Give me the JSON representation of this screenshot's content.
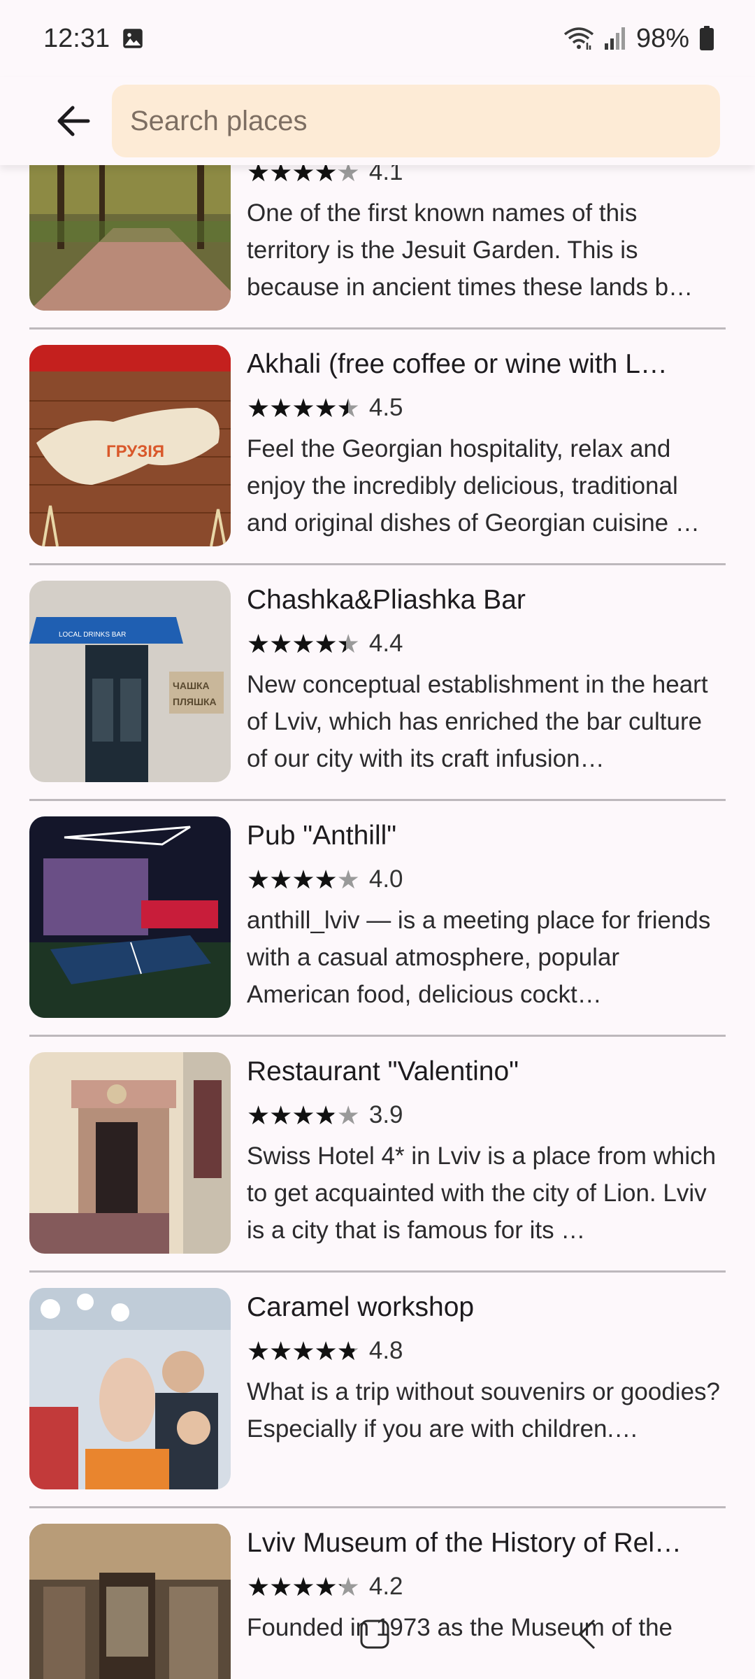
{
  "status_bar": {
    "time": "12:31",
    "battery": "98%",
    "icons": [
      "image-icon",
      "wifi-icon",
      "signal-icon",
      "battery-icon"
    ]
  },
  "header": {
    "back_icon": "arrow-back-icon",
    "search_placeholder": "Search places"
  },
  "places": [
    {
      "title": "",
      "rating": 4.1,
      "rating_text": "4.1",
      "description": "One of the first known names of this territory is the Jesuit Garden. This is because in ancient times these lands b…"
    },
    {
      "title": "Akhali (free coffee or wine with L…",
      "rating": 4.5,
      "rating_text": "4.5",
      "description": "Feel the Georgian hospitality, relax and enjoy the incredibly delicious, traditional and original dishes of Georgian cuisine …"
    },
    {
      "title": "Chashka&Pliashka Bar",
      "rating": 4.4,
      "rating_text": "4.4",
      "description": "New conceptual establishment in the heart of Lviv, which has enriched the bar culture of our city with its craft infusion…"
    },
    {
      "title": "Pub \"Anthill\"",
      "rating": 4.0,
      "rating_text": "4.0",
      "description": "anthill_lviv — is a meeting place for friends with a casual atmosphere, popular American food, delicious cockt…"
    },
    {
      "title": "Restaurant \"Valentino\"",
      "rating": 3.9,
      "rating_text": "3.9",
      "description": "Swiss Hotel 4* in Lviv is a place from which to get acquainted with the city of Lion. Lviv is a city that is famous for its …"
    },
    {
      "title": "Caramel workshop",
      "rating": 4.8,
      "rating_text": "4.8",
      "description": "What is a trip without souvenirs or goodies? Especially if you are with children.…"
    },
    {
      "title": "Lviv Museum of the History of Rel…",
      "rating": 4.2,
      "rating_text": "4.2",
      "description": "Founded in 1973 as the Museum of the"
    }
  ],
  "thumb_labels": {
    "akhali_map": "ГРУЗІЯ",
    "bar_awning": "LOCAL DRINKS BAR",
    "bar_sign_1": "ЧАШКА",
    "bar_sign_2": "ПЛЯШКА"
  },
  "nav": [
    "home-nav-icon",
    "back-nav-icon"
  ]
}
